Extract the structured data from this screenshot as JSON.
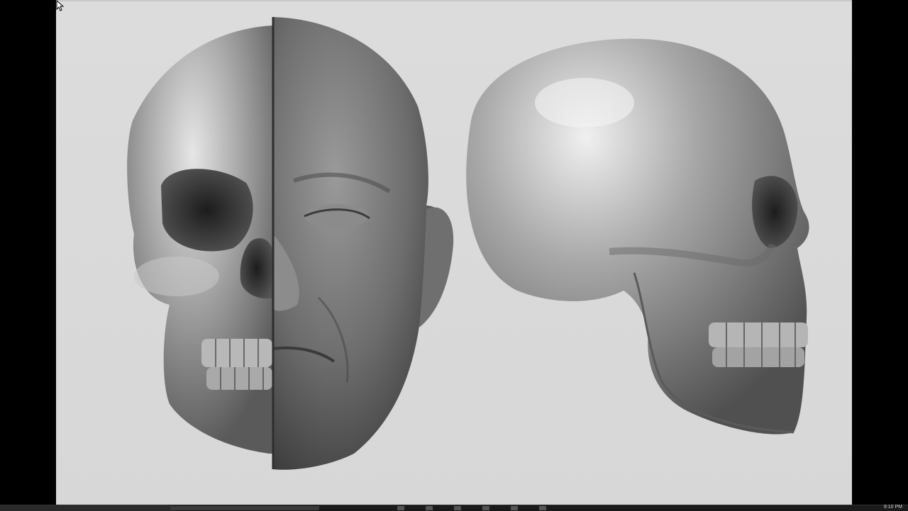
{
  "viewport": {
    "background": "#d9d9d9",
    "models": [
      {
        "name": "skull-face-split-front-view"
      },
      {
        "name": "skull-side-view"
      }
    ]
  },
  "cursor": {
    "icon": "arrow-cursor-icon"
  },
  "taskbar": {
    "clock": "9:10 PM",
    "icons": [
      "start-icon",
      "search-icon",
      "task-view-icon",
      "browser-icon",
      "folder-icon",
      "app-icon",
      "app-icon",
      "app-icon"
    ]
  }
}
